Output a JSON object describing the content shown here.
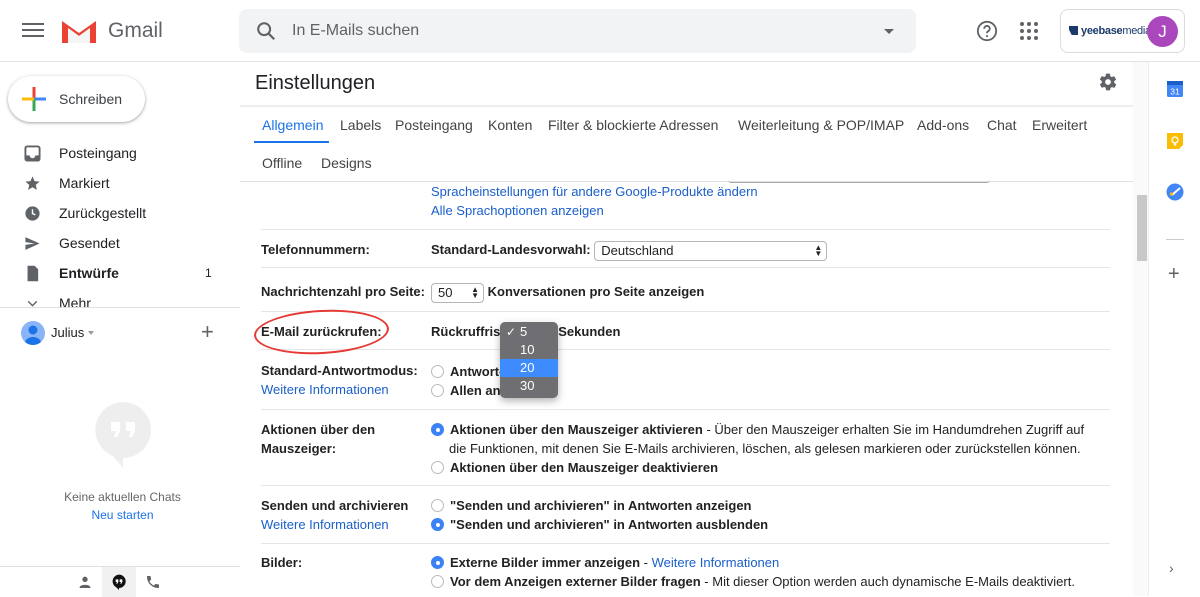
{
  "header": {
    "app_name": "Gmail",
    "search_placeholder": "In E-Mails suchen",
    "account_brand_bold": "yeebase",
    "account_brand_light": "media",
    "avatar_initial": "J",
    "icons": [
      "menu-icon",
      "gmail-logo",
      "search-icon",
      "search-options-icon",
      "help-icon",
      "apps-icon"
    ]
  },
  "sidebar": {
    "compose_label": "Schreiben",
    "items": [
      {
        "label": "Posteingang",
        "icon": "inbox-icon",
        "count": ""
      },
      {
        "label": "Markiert",
        "icon": "star-icon",
        "count": ""
      },
      {
        "label": "Zurückgestellt",
        "icon": "clock-icon",
        "count": ""
      },
      {
        "label": "Gesendet",
        "icon": "send-icon",
        "count": ""
      },
      {
        "label": "Entwürfe",
        "icon": "draft-icon",
        "count": "1",
        "bold": true
      },
      {
        "label": "Mehr",
        "icon": "chevron-down-icon",
        "count": ""
      }
    ],
    "hangouts_user": "Julius",
    "no_chats": "Keine aktuellen Chats",
    "start_new": "Neu starten"
  },
  "settings": {
    "title": "Einstellungen",
    "tabs": [
      {
        "label": "Allgemein",
        "active": true
      },
      {
        "label": "Labels"
      },
      {
        "label": "Posteingang"
      },
      {
        "label": "Konten"
      },
      {
        "label": "Filter & blockierte Adressen"
      },
      {
        "label": "Weiterleitung & POP/IMAP"
      },
      {
        "label": "Add-ons"
      },
      {
        "label": "Chat"
      },
      {
        "label": "Erweitert"
      },
      {
        "label": "Offline"
      },
      {
        "label": "Designs"
      }
    ],
    "language_links": {
      "other_products": "Spracheinstellungen für andere Google-Produkte ändern",
      "all_options": "Alle Sprachoptionen anzeigen"
    },
    "phone": {
      "label": "Telefonnummern:",
      "field_label": "Standard-Landesvorwahl:",
      "value": "Deutschland"
    },
    "page_size": {
      "label": "Nachrichtenzahl pro Seite:",
      "value": "50",
      "suffix": "Konversationen pro Seite anzeigen"
    },
    "undo_send": {
      "label": "E-Mail zurückrufen:",
      "prefix": "Rückruffrist:",
      "suffix": "Sekunden",
      "options": [
        "5",
        "10",
        "20",
        "30"
      ],
      "selected": "5",
      "highlighted": "20"
    },
    "reply_mode": {
      "label": "Standard-Antwortmodus:",
      "more_info": "Weitere Informationen",
      "options": [
        "Antworten",
        "Allen antworten"
      ],
      "visible_options": [
        "Antworte",
        "Allen ant"
      ]
    },
    "hover_actions": {
      "label_line1": "Aktionen über den",
      "label_line2": "Mauszeiger:",
      "option_on": "Aktionen über den Mauszeiger aktivieren",
      "option_on_desc": " - Über den Mauszeiger erhalten Sie im Handumdrehen Zugriff auf",
      "option_on_desc2": "die Funktionen, mit denen Sie E-Mails archivieren, löschen, als gelesen markieren oder zurückstellen können.",
      "option_off": "Aktionen über den Mauszeiger deaktivieren",
      "selected": "on"
    },
    "send_archive": {
      "label": "Senden und archivieren",
      "more_info": "Weitere Informationen",
      "option_show": "\"Senden und archivieren\" in Antworten anzeigen",
      "option_hide": "\"Senden und archivieren\" in Antworten ausblenden",
      "selected": "hide"
    },
    "images": {
      "label": "Bilder:",
      "option_always": "Externe Bilder immer anzeigen",
      "option_always_link": "Weitere Informationen",
      "option_ask": "Vor dem Anzeigen externer Bilder fragen",
      "option_ask_desc": " - Mit dieser Option werden auch dynamische E-Mails deaktiviert.",
      "selected": "always"
    }
  },
  "right_panel": {
    "calendar_day": "31",
    "icons": [
      "calendar-icon",
      "keep-icon",
      "tasks-icon",
      "add-addon-icon",
      "expand-panel-icon"
    ]
  },
  "colors": {
    "accent": "#1a73e8",
    "avatar": "#ab47bc",
    "annotation": "#e53935",
    "popup_highlight": "#3d8bfd"
  }
}
